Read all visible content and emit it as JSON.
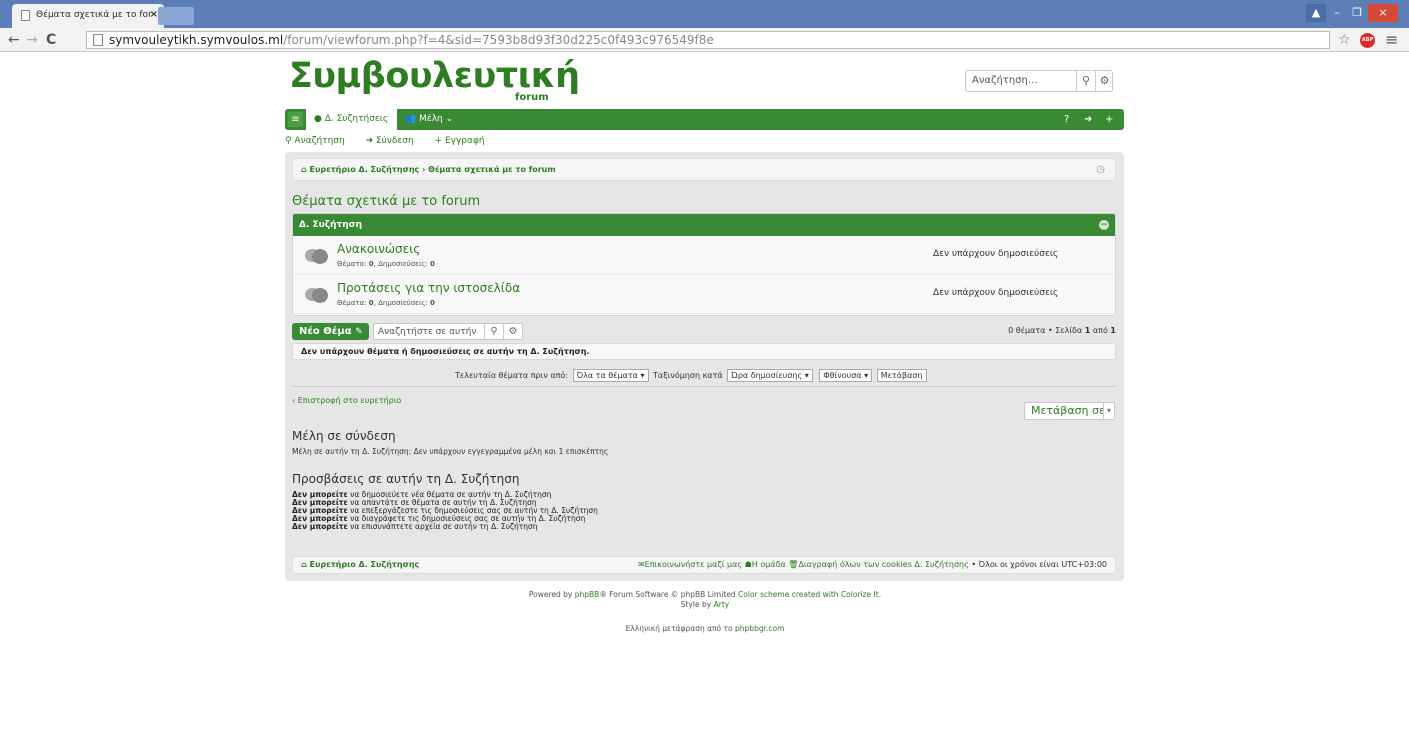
{
  "browser": {
    "tab_title": "Θέματα σχετικά με το for",
    "url_host": "symvouleytikh.symvoulos.ml",
    "url_path": "/forum/viewforum.php?f=4&sid=7593b8d93f30d225c0f493c976549f8e",
    "abp_label": "ABP"
  },
  "header": {
    "logo": "Συμβουλευτική",
    "logo_sub": "forum",
    "search_placeholder": "Αναζήτηση…"
  },
  "navbar": {
    "tab_label": "Δ. Συζητήσεις",
    "members_label": "Μέλη"
  },
  "quick_links": [
    "Αναζήτηση",
    "Σύνδεση",
    "Εγγραφή"
  ],
  "breadcrumb": {
    "home": "Ευρετήριο Δ. Συζήτησης",
    "separator": "›",
    "current": "Θέματα σχετικά με το forum"
  },
  "forum_title": "Θέματα σχετικά με το forum",
  "forum_box": {
    "header": "Δ. Συζήτηση",
    "rows": [
      {
        "name": "Ανακοινώσεις",
        "topics_label": "Θέματα:",
        "topics": "0",
        "posts_label": "Δημοσιεύσεις:",
        "posts": "0",
        "last": "Δεν υπάρχουν δημοσιεύσεις"
      },
      {
        "name": "Προτάσεις για την ιστοσελίδα",
        "topics_label": "Θέματα:",
        "topics": "0",
        "posts_label": "Δημοσιεύσεις:",
        "posts": "0",
        "last": "Δεν υπάρχουν δημοσιεύσεις"
      }
    ]
  },
  "actions": {
    "new_topic": "Νέο Θέμα",
    "search_placeholder": "Αναζητήστε σε αυτήν",
    "pagination_prefix": "0 θέματα • Σελίδα",
    "page": "1",
    "page_of": "από",
    "page_total": "1"
  },
  "notice": "Δεν υπάρχουν θέματα ή δημοσιεύσεις σε αυτήν τη Δ. Συζήτηση.",
  "sort": {
    "show_label": "Τελευταία θέματα πριν από:",
    "show_value": "Όλα τα θέματα",
    "sort_label": "Ταξινόμηση κατά",
    "sort_value": "Ώρα δημοσίευσης",
    "dir_value": "Φθίνουσα",
    "go": "Μετάβαση"
  },
  "back_link": "‹ Επιστροφή στο ευρετήριο",
  "jump_label": "Μετάβαση σε",
  "online": {
    "title": "Μέλη σε σύνδεση",
    "text": "Μέλη σε αυτήν τη Δ. Συζήτηση: Δεν υπάρχουν εγγεγραμμένα μέλη και 1 επισκέπτης"
  },
  "permissions": {
    "title": "Προσβάσεις σε αυτήν τη Δ. Συζήτηση",
    "cannot": "Δεν μπορείτε",
    "items": [
      "να δημοσιεύετε νέα θέματα σε αυτήν τη Δ. Συζήτηση",
      "να απαντάτε σε θέματα σε αυτήν τη Δ. Συζήτηση",
      "να επεξεργάζεστε τις δημοσιεύσεις σας σε αυτήν τη Δ. Συζήτηση",
      "να διαγράφετε τις δημοσιεύσεις σας σε αυτήν τη Δ. Συζήτηση",
      "να επισυνάπτετε αρχεία σε αυτήν τη Δ. Συζήτηση"
    ]
  },
  "footer_bar": {
    "home": "Ευρετήριο Δ. Συζήτησης",
    "contact": "Επικοινωνήστε μαζί μας",
    "team": "Η ομάδα",
    "cookies": "Διαγραφή όλων των cookies Δ. Συζήτησης",
    "timezone": "• Όλοι οι χρόνοι είναι UTC+03:00"
  },
  "powered": {
    "line1_pre": "Powered by",
    "phpbb": "phpBB",
    "line1_mid": "® Forum Software © phpBB Limited",
    "color_scheme": "Color scheme created with Colorize It.",
    "line2_pre": "Style by",
    "style_author": "Arty"
  },
  "translation": {
    "text": "Ελληνική μετάφραση από το",
    "link": "phpbbgr.com"
  },
  "colors": {
    "accent": "#3a8a35",
    "link": "#2e7d22",
    "chrome": "#5c7fb8"
  }
}
